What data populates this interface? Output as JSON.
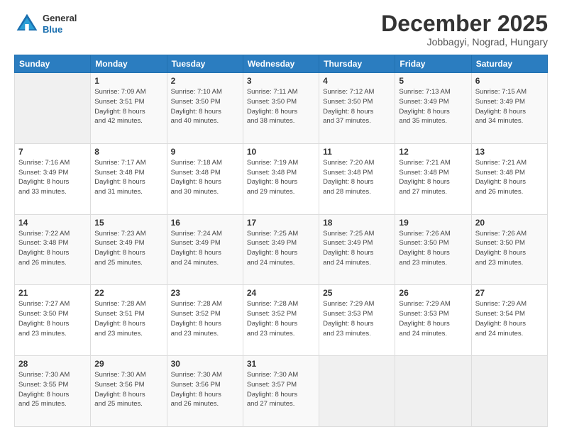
{
  "logo": {
    "general": "General",
    "blue": "Blue"
  },
  "header": {
    "month_year": "December 2025",
    "location": "Jobbagyi, Nograd, Hungary"
  },
  "weekdays": [
    "Sunday",
    "Monday",
    "Tuesday",
    "Wednesday",
    "Thursday",
    "Friday",
    "Saturday"
  ],
  "weeks": [
    [
      {
        "day": "",
        "info": ""
      },
      {
        "day": "1",
        "info": "Sunrise: 7:09 AM\nSunset: 3:51 PM\nDaylight: 8 hours\nand 42 minutes."
      },
      {
        "day": "2",
        "info": "Sunrise: 7:10 AM\nSunset: 3:50 PM\nDaylight: 8 hours\nand 40 minutes."
      },
      {
        "day": "3",
        "info": "Sunrise: 7:11 AM\nSunset: 3:50 PM\nDaylight: 8 hours\nand 38 minutes."
      },
      {
        "day": "4",
        "info": "Sunrise: 7:12 AM\nSunset: 3:50 PM\nDaylight: 8 hours\nand 37 minutes."
      },
      {
        "day": "5",
        "info": "Sunrise: 7:13 AM\nSunset: 3:49 PM\nDaylight: 8 hours\nand 35 minutes."
      },
      {
        "day": "6",
        "info": "Sunrise: 7:15 AM\nSunset: 3:49 PM\nDaylight: 8 hours\nand 34 minutes."
      }
    ],
    [
      {
        "day": "7",
        "info": "Sunrise: 7:16 AM\nSunset: 3:49 PM\nDaylight: 8 hours\nand 33 minutes."
      },
      {
        "day": "8",
        "info": "Sunrise: 7:17 AM\nSunset: 3:48 PM\nDaylight: 8 hours\nand 31 minutes."
      },
      {
        "day": "9",
        "info": "Sunrise: 7:18 AM\nSunset: 3:48 PM\nDaylight: 8 hours\nand 30 minutes."
      },
      {
        "day": "10",
        "info": "Sunrise: 7:19 AM\nSunset: 3:48 PM\nDaylight: 8 hours\nand 29 minutes."
      },
      {
        "day": "11",
        "info": "Sunrise: 7:20 AM\nSunset: 3:48 PM\nDaylight: 8 hours\nand 28 minutes."
      },
      {
        "day": "12",
        "info": "Sunrise: 7:21 AM\nSunset: 3:48 PM\nDaylight: 8 hours\nand 27 minutes."
      },
      {
        "day": "13",
        "info": "Sunrise: 7:21 AM\nSunset: 3:48 PM\nDaylight: 8 hours\nand 26 minutes."
      }
    ],
    [
      {
        "day": "14",
        "info": "Sunrise: 7:22 AM\nSunset: 3:48 PM\nDaylight: 8 hours\nand 26 minutes."
      },
      {
        "day": "15",
        "info": "Sunrise: 7:23 AM\nSunset: 3:49 PM\nDaylight: 8 hours\nand 25 minutes."
      },
      {
        "day": "16",
        "info": "Sunrise: 7:24 AM\nSunset: 3:49 PM\nDaylight: 8 hours\nand 24 minutes."
      },
      {
        "day": "17",
        "info": "Sunrise: 7:25 AM\nSunset: 3:49 PM\nDaylight: 8 hours\nand 24 minutes."
      },
      {
        "day": "18",
        "info": "Sunrise: 7:25 AM\nSunset: 3:49 PM\nDaylight: 8 hours\nand 24 minutes."
      },
      {
        "day": "19",
        "info": "Sunrise: 7:26 AM\nSunset: 3:50 PM\nDaylight: 8 hours\nand 23 minutes."
      },
      {
        "day": "20",
        "info": "Sunrise: 7:26 AM\nSunset: 3:50 PM\nDaylight: 8 hours\nand 23 minutes."
      }
    ],
    [
      {
        "day": "21",
        "info": "Sunrise: 7:27 AM\nSunset: 3:50 PM\nDaylight: 8 hours\nand 23 minutes."
      },
      {
        "day": "22",
        "info": "Sunrise: 7:28 AM\nSunset: 3:51 PM\nDaylight: 8 hours\nand 23 minutes."
      },
      {
        "day": "23",
        "info": "Sunrise: 7:28 AM\nSunset: 3:52 PM\nDaylight: 8 hours\nand 23 minutes."
      },
      {
        "day": "24",
        "info": "Sunrise: 7:28 AM\nSunset: 3:52 PM\nDaylight: 8 hours\nand 23 minutes."
      },
      {
        "day": "25",
        "info": "Sunrise: 7:29 AM\nSunset: 3:53 PM\nDaylight: 8 hours\nand 23 minutes."
      },
      {
        "day": "26",
        "info": "Sunrise: 7:29 AM\nSunset: 3:53 PM\nDaylight: 8 hours\nand 24 minutes."
      },
      {
        "day": "27",
        "info": "Sunrise: 7:29 AM\nSunset: 3:54 PM\nDaylight: 8 hours\nand 24 minutes."
      }
    ],
    [
      {
        "day": "28",
        "info": "Sunrise: 7:30 AM\nSunset: 3:55 PM\nDaylight: 8 hours\nand 25 minutes."
      },
      {
        "day": "29",
        "info": "Sunrise: 7:30 AM\nSunset: 3:56 PM\nDaylight: 8 hours\nand 25 minutes."
      },
      {
        "day": "30",
        "info": "Sunrise: 7:30 AM\nSunset: 3:56 PM\nDaylight: 8 hours\nand 26 minutes."
      },
      {
        "day": "31",
        "info": "Sunrise: 7:30 AM\nSunset: 3:57 PM\nDaylight: 8 hours\nand 27 minutes."
      },
      {
        "day": "",
        "info": ""
      },
      {
        "day": "",
        "info": ""
      },
      {
        "day": "",
        "info": ""
      }
    ]
  ]
}
